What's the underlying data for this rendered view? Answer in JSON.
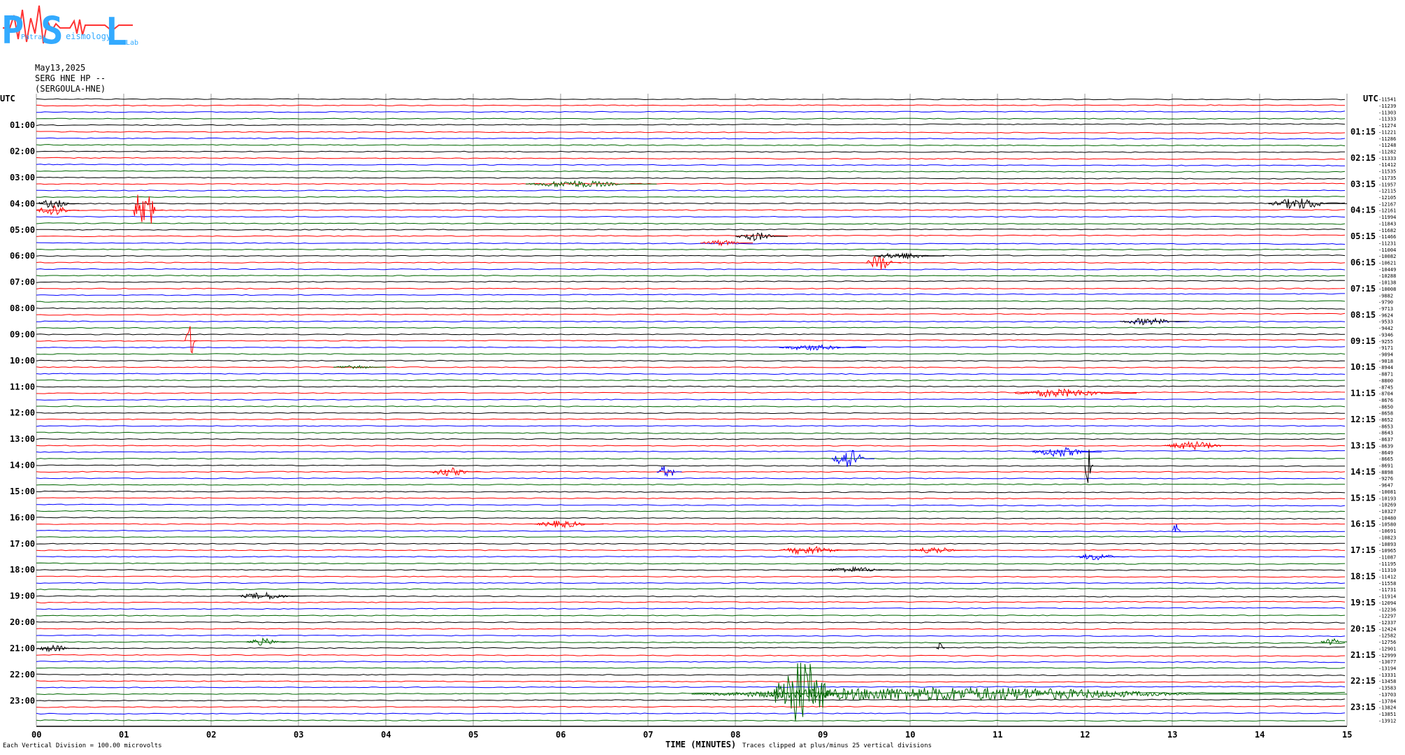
{
  "logo": {
    "letters": [
      "P",
      "S",
      "L"
    ],
    "words": [
      "Patras",
      "eismology",
      "Lab"
    ]
  },
  "header": {
    "date": "May13,2025",
    "station": "SERG HNE HP --",
    "name": "(SERGOULA-HNE)"
  },
  "axes": {
    "left_label": "UTC",
    "right_label": "UTC",
    "xlabel": "TIME (MINUTES)",
    "left_hours": [
      "01:00",
      "02:00",
      "03:00",
      "04:00",
      "05:00",
      "06:00",
      "07:00",
      "08:00",
      "09:00",
      "10:00",
      "11:00",
      "12:00",
      "13:00",
      "14:00",
      "15:00",
      "16:00",
      "17:00",
      "18:00",
      "19:00",
      "20:00",
      "21:00",
      "22:00",
      "23:00"
    ],
    "right_hours": [
      "01:15",
      "02:15",
      "03:15",
      "04:15",
      "05:15",
      "06:15",
      "07:15",
      "08:15",
      "09:15",
      "10:15",
      "11:15",
      "12:15",
      "13:15",
      "14:15",
      "15:15",
      "16:15",
      "17:15",
      "18:15",
      "19:15",
      "20:15",
      "21:15",
      "22:15",
      "23:15"
    ],
    "x_ticks": [
      "00",
      "01",
      "02",
      "03",
      "04",
      "05",
      "06",
      "07",
      "08",
      "09",
      "10",
      "11",
      "12",
      "13",
      "14",
      "15"
    ]
  },
  "footer": {
    "scale_note": "Each Vertical Division =  100.00 microvolts",
    "clip_note": "Traces clipped at plus/minus 25 vertical divisions"
  },
  "chart_data": {
    "type": "line",
    "title": "",
    "xlabel": "TIME (MINUTES)",
    "ylabel": "UTC",
    "xlim": [
      0,
      15
    ],
    "grid": true,
    "trace_colors": [
      "#000000",
      "#ff0000",
      "#0000ff",
      "#006600"
    ],
    "trace_count": 96,
    "minutes_per_trace": 15,
    "offsets": [
      -11541,
      -11239,
      -11303,
      -11333,
      -11274,
      -11221,
      -11286,
      -11248,
      -11282,
      -11333,
      -11412,
      -11535,
      -11735,
      -11957,
      -12115,
      -12105,
      -12167,
      -12161,
      -11994,
      -11843,
      -11682,
      -11466,
      -11231,
      -11004,
      -10082,
      -10621,
      -10449,
      -10288,
      -10138,
      -10008,
      -9882,
      -9790,
      -9713,
      -9624,
      -9533,
      -9442,
      -9346,
      -9255,
      -9171,
      -9094,
      -9018,
      -8944,
      -8871,
      -8800,
      -8745,
      -8704,
      -8676,
      -8650,
      -8658,
      -8652,
      -8653,
      -8643,
      -8637,
      -8639,
      -8649,
      -8665,
      -8691,
      -8898,
      -9276,
      -9647,
      -10081,
      -10193,
      -10269,
      -10327,
      -10480,
      -10580,
      -10691,
      -10823,
      -10893,
      -10965,
      -11087,
      -11195,
      -11310,
      -11412,
      -11558,
      -11731,
      -11914,
      -12094,
      -12236,
      -12297,
      -12337,
      -12424,
      -12582,
      -12756,
      -12901,
      -12999,
      -13077,
      -13194,
      -13331,
      -13458,
      -13583,
      -13703,
      -13784,
      -13824,
      -13851,
      -13912
    ],
    "events": [
      {
        "trace": 16,
        "minute": 0.0,
        "duration": 0.5,
        "amp": 6,
        "color_index": 0
      },
      {
        "trace": 17,
        "minute": 0.0,
        "duration": 0.5,
        "amp": 9,
        "color_index": 1
      },
      {
        "trace": 17,
        "minute": 1.1,
        "duration": 0.35,
        "amp": 38,
        "color_index": 1
      },
      {
        "trace": 13,
        "minute": 5.6,
        "duration": 1.5,
        "amp": 5,
        "color_index": 3
      },
      {
        "trace": 16,
        "minute": 14.1,
        "duration": 0.9,
        "amp": 8,
        "color_index": 0
      },
      {
        "trace": 21,
        "minute": 8.0,
        "duration": 0.6,
        "amp": 6,
        "color_index": 0
      },
      {
        "trace": 22,
        "minute": 7.6,
        "duration": 0.6,
        "amp": 4,
        "color_index": 1
      },
      {
        "trace": 25,
        "minute": 9.5,
        "duration": 0.4,
        "amp": 12,
        "color_index": 1
      },
      {
        "trace": 24,
        "minute": 9.6,
        "duration": 0.8,
        "amp": 5,
        "color_index": 0
      },
      {
        "trace": 37,
        "minute": 1.7,
        "duration": 0.15,
        "amp": 25,
        "color_index": 1
      },
      {
        "trace": 34,
        "minute": 12.4,
        "duration": 0.8,
        "amp": 5,
        "color_index": 0
      },
      {
        "trace": 38,
        "minute": 8.5,
        "duration": 1.0,
        "amp": 4,
        "color_index": 2
      },
      {
        "trace": 41,
        "minute": 3.4,
        "duration": 0.6,
        "amp": 3,
        "color_index": 3
      },
      {
        "trace": 45,
        "minute": 11.2,
        "duration": 1.4,
        "amp": 6,
        "color_index": 1
      },
      {
        "trace": 53,
        "minute": 12.9,
        "duration": 0.9,
        "amp": 6,
        "color_index": 1
      },
      {
        "trace": 54,
        "minute": 11.4,
        "duration": 0.8,
        "amp": 7,
        "color_index": 2
      },
      {
        "trace": 55,
        "minute": 9.1,
        "duration": 0.5,
        "amp": 14,
        "color_index": 2
      },
      {
        "trace": 56,
        "minute": 12.0,
        "duration": 0.1,
        "amp": 30,
        "color_index": 0
      },
      {
        "trace": 57,
        "minute": 7.1,
        "duration": 0.3,
        "amp": 9,
        "color_index": 2
      },
      {
        "trace": 57,
        "minute": 4.5,
        "duration": 0.6,
        "amp": 6,
        "color_index": 1
      },
      {
        "trace": 65,
        "minute": 5.7,
        "duration": 0.8,
        "amp": 5,
        "color_index": 1
      },
      {
        "trace": 66,
        "minute": 13.0,
        "duration": 0.1,
        "amp": 10,
        "color_index": 2
      },
      {
        "trace": 69,
        "minute": 8.5,
        "duration": 0.9,
        "amp": 6,
        "color_index": 1
      },
      {
        "trace": 69,
        "minute": 10.0,
        "duration": 0.7,
        "amp": 5,
        "color_index": 1
      },
      {
        "trace": 70,
        "minute": 11.9,
        "duration": 0.6,
        "amp": 5,
        "color_index": 2
      },
      {
        "trace": 72,
        "minute": 9.0,
        "duration": 0.9,
        "amp": 4,
        "color_index": 0
      },
      {
        "trace": 76,
        "minute": 2.3,
        "duration": 0.8,
        "amp": 5,
        "color_index": 0
      },
      {
        "trace": 83,
        "minute": 14.7,
        "duration": 0.3,
        "amp": 5,
        "color_index": 3
      },
      {
        "trace": 83,
        "minute": 2.4,
        "duration": 0.5,
        "amp": 5,
        "color_index": 3
      },
      {
        "trace": 84,
        "minute": 0.0,
        "duration": 0.5,
        "amp": 5,
        "color_index": 0
      },
      {
        "trace": 84,
        "minute": 10.3,
        "duration": 0.1,
        "amp": 12,
        "color_index": 0
      },
      {
        "trace": 91,
        "minute": 7.5,
        "duration": 7.5,
        "amp": 10,
        "color_index": 3
      },
      {
        "trace": 91,
        "minute": 8.4,
        "duration": 0.9,
        "amp": 50,
        "color_index": 3
      }
    ]
  }
}
